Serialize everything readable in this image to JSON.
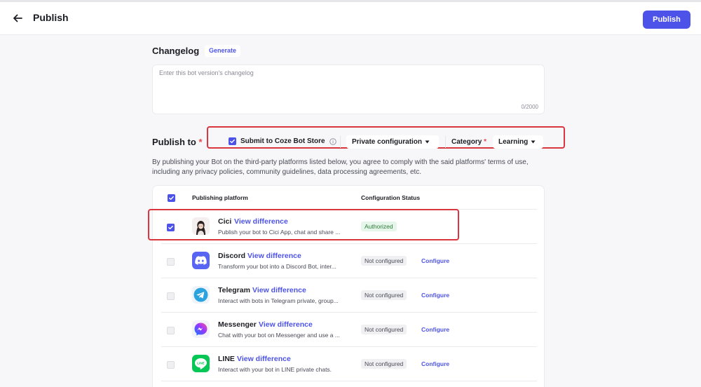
{
  "header": {
    "title": "Publish",
    "publish_label": "Publish"
  },
  "changelog": {
    "title": "Changelog",
    "generate_label": "Generate",
    "placeholder": "Enter this bot version's changelog",
    "count": "0/2000"
  },
  "publish_to": {
    "title": "Publish to",
    "required": "*",
    "store_label": "Submit to Coze Bot Store",
    "store_checked": true,
    "config_label": "Private configuration",
    "category_label": "Category",
    "category_value": "Learning"
  },
  "disclaimer": "By publishing your Bot on the third-party platforms listed below, you agree to comply with the said platforms' terms of use, including any privacy policies, community guidelines, data processing agreements, etc.",
  "table": {
    "col_platform": "Publishing platform",
    "col_status": "Configuration Status",
    "view_diff_label": "View difference",
    "configure_label": "Configure",
    "rows": [
      {
        "name": "Cici",
        "desc": "Publish your bot to Cici App, chat and share ...",
        "status": "Authorized",
        "checked": true,
        "icon": "cici-avatar-icon"
      },
      {
        "name": "Discord",
        "desc": "Transform your bot into a Discord Bot, inter...",
        "status": "Not configured",
        "checked": false,
        "icon": "discord-icon"
      },
      {
        "name": "Telegram",
        "desc": "Interact with bots in Telegram private, group...",
        "status": "Not configured",
        "checked": false,
        "icon": "telegram-icon"
      },
      {
        "name": "Messenger",
        "desc": "Chat with your bot on Messenger and use a ...",
        "status": "Not configured",
        "checked": false,
        "icon": "messenger-icon"
      },
      {
        "name": "LINE",
        "desc": "Interact with your bot in LINE private chats.",
        "status": "Not configured",
        "checked": false,
        "icon": "line-icon"
      }
    ]
  },
  "colors": {
    "accent": "#4d53e8",
    "highlight": "#d9363e",
    "authorized_bg": "#e6f6ea",
    "authorized_text": "#2f7a3a"
  }
}
